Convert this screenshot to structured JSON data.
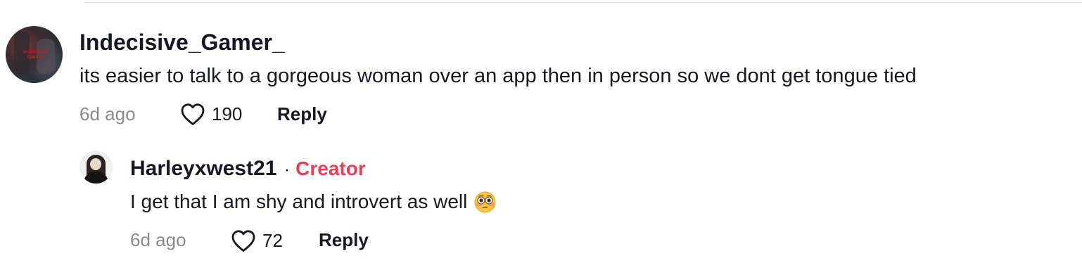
{
  "comment": {
    "username": "Indecisive_Gamer_",
    "avatar_label": "Indecisive Gamer",
    "text": "its easier to talk to a gorgeous woman over an app then in person so we dont get tongue tied",
    "time": "6d ago",
    "likes": "190",
    "reply_label": "Reply"
  },
  "reply": {
    "username": "Harleyxwest21",
    "separator": "·",
    "badge": "Creator",
    "text": "I get that I am shy and introvert as well",
    "emoji": "flushed-face",
    "time": "6d ago",
    "likes": "72",
    "reply_label": "Reply"
  },
  "icons": {
    "like": "heart-icon"
  },
  "colors": {
    "text": "#161823",
    "muted": "#8a8b91",
    "creator": "#e3405a"
  }
}
